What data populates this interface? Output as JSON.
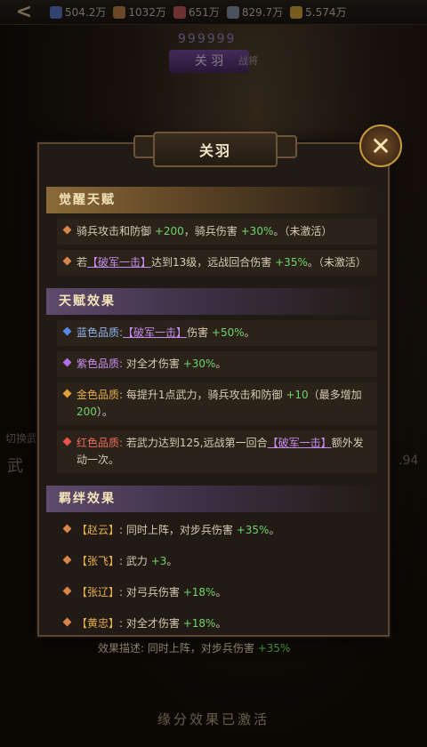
{
  "topbar": {
    "back": "<",
    "currencies": [
      {
        "icon": "coin-icon",
        "color": "#5a7ac8",
        "value": "504.2万"
      },
      {
        "icon": "wood-icon",
        "color": "#c0834a",
        "value": "1032万"
      },
      {
        "icon": "food-icon",
        "color": "#c85a5a",
        "value": "651万"
      },
      {
        "icon": "iron-icon",
        "color": "#8898a8",
        "value": "829.7万"
      },
      {
        "icon": "gold-icon",
        "color": "#d8a83a",
        "value": "5.574万"
      }
    ]
  },
  "hero": {
    "stars": "999999",
    "tab": "关 羽",
    "sub": "战将"
  },
  "background_texts": {
    "left_label": "切换武",
    "left_big": "武",
    "right_num": ".94",
    "footer_desc": "效果描述: 同时上阵，对步兵伤害",
    "footer_val": "+35%",
    "footer_bottom": "缘分效果已激活"
  },
  "modal": {
    "title": "关羽",
    "sections": [
      {
        "heading": "觉醒天赋",
        "style": "gold"
      },
      {
        "heading": "天赋效果",
        "style": "purple"
      },
      {
        "heading": "羁绊效果",
        "style": "purple"
      }
    ],
    "awaken": [
      {
        "a": "骑兵攻击和防御 ",
        "b": "+200",
        "c": "，骑兵伤害 ",
        "d": "+30%",
        "e": "。（未激活）"
      },
      {
        "a": "若",
        "skill": "【破军一击】",
        "c": "达到13级，远战回合伤害 ",
        "d": "+35%",
        "e": "。（未激活）"
      }
    ],
    "talents": [
      {
        "label": "蓝色品质:",
        "color": "blue",
        "skill": "【破军一击】",
        "c": "伤害 ",
        "d": "+50%",
        "e": "。"
      },
      {
        "label": "紫色品质:",
        "color": "purple",
        "c": " 对全才伤害 ",
        "d": "+30%",
        "e": "。"
      },
      {
        "label": "金色品质:",
        "color": "gold",
        "c": " 每提升1点武力，骑兵攻击和防御 ",
        "d": "+10",
        "e": "（最多增加 ",
        "f": "200",
        "g": "）。"
      },
      {
        "label": "红色品质:",
        "color": "red",
        "c": " 若武力达到125,远战第一回合",
        "skill": "【破军一击】",
        "e": "额外发动一次。"
      }
    ],
    "bonds": [
      {
        "name": "【赵云】",
        "c": ": 同时上阵，对步兵伤害 ",
        "d": "+35%",
        "e": "。"
      },
      {
        "name": "【张飞】",
        "c": ": 武力 ",
        "d": "+3",
        "e": "。"
      },
      {
        "name": "【张辽】",
        "c": ": 对弓兵伤害 ",
        "d": "+18%",
        "e": "。"
      },
      {
        "name": "【黄忠】",
        "c": ": 对全才伤害 ",
        "d": "+18%",
        "e": "。"
      }
    ]
  }
}
